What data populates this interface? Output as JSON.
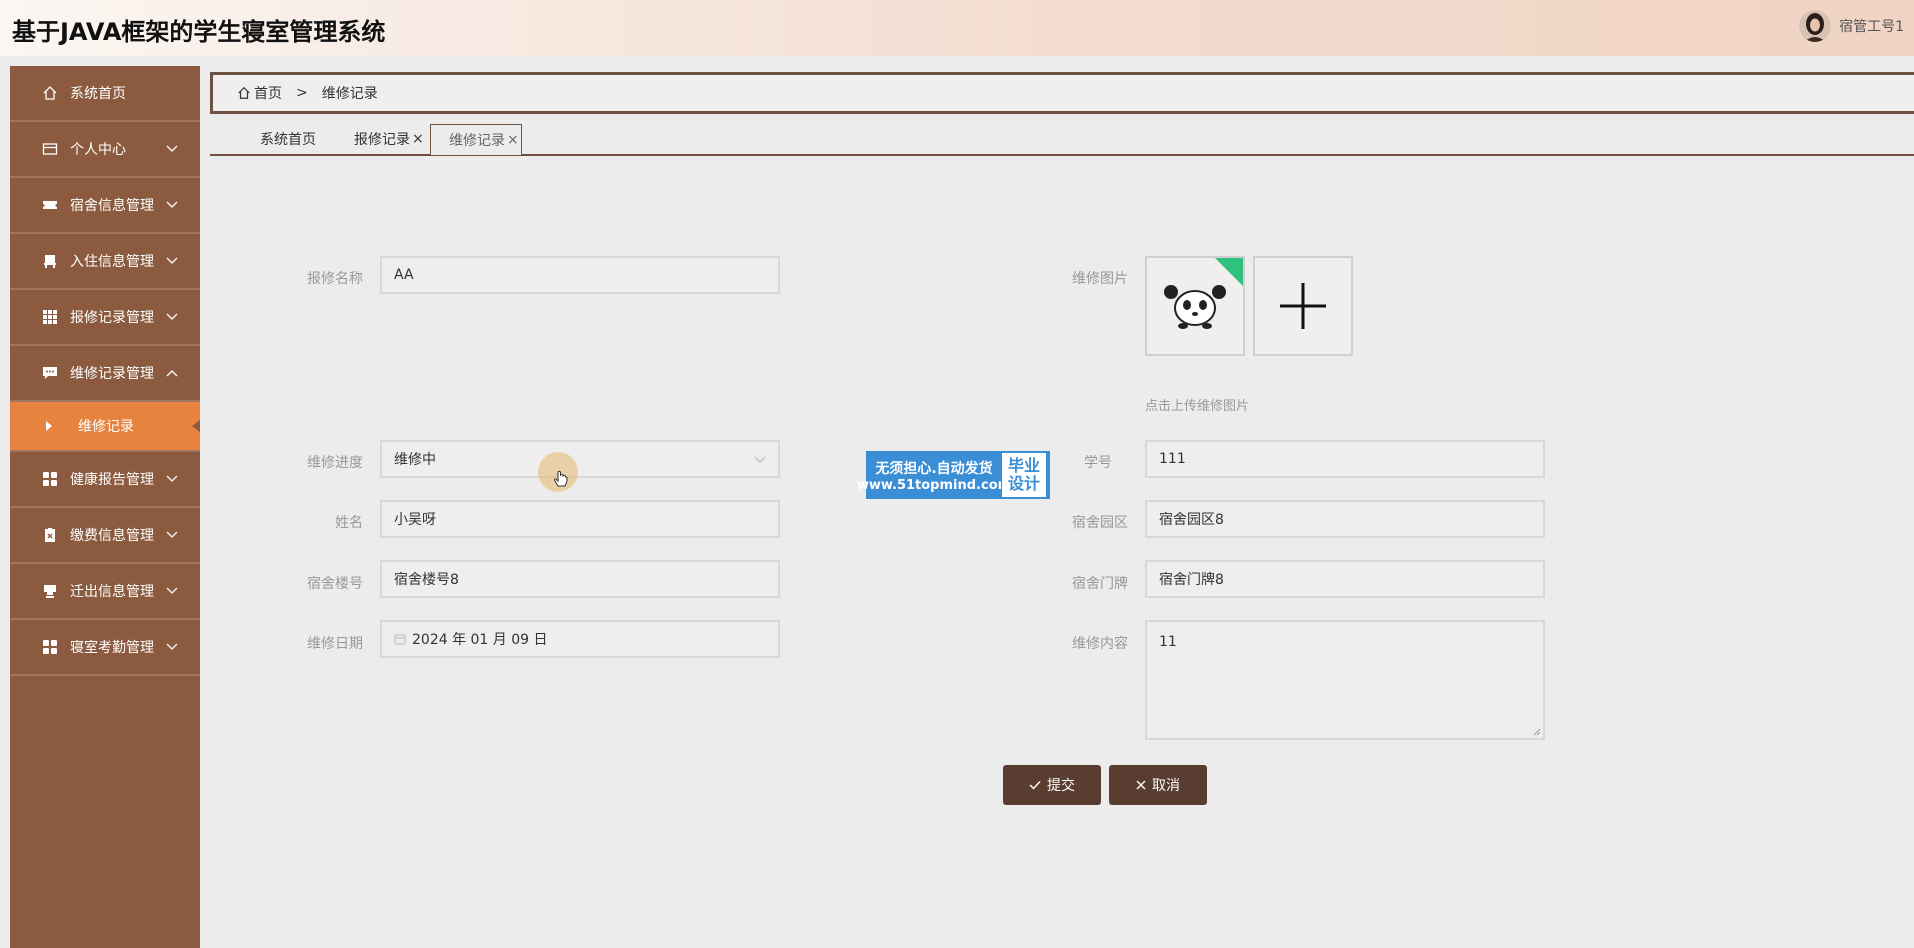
{
  "header": {
    "title": "基于JAVA框架的学生寝室管理系统",
    "user": "宿管工号1"
  },
  "sidebar": {
    "items": [
      {
        "label": "系统首页",
        "icon": "home-icon"
      },
      {
        "label": "个人中心",
        "icon": "card-icon"
      },
      {
        "label": "宿舍信息管理",
        "icon": "ticket-icon"
      },
      {
        "label": "入住信息管理",
        "icon": "chair-icon"
      },
      {
        "label": "报修记录管理",
        "icon": "grid-icon"
      },
      {
        "label": "维修记录管理",
        "icon": "chat-icon"
      },
      {
        "label": "健康报告管理",
        "icon": "apps-icon"
      },
      {
        "label": "缴费信息管理",
        "icon": "clipboard-icon"
      },
      {
        "label": "迁出信息管理",
        "icon": "cup-icon"
      },
      {
        "label": "寝室考勤管理",
        "icon": "apps-icon"
      }
    ],
    "sub_item": "维修记录"
  },
  "breadcrumb": {
    "home": "首页",
    "separator": ">",
    "current": "维修记录"
  },
  "tabs": [
    {
      "label": "系统首页"
    },
    {
      "label": "报修记录",
      "close": "×"
    },
    {
      "label": "维修记录",
      "close": "×"
    }
  ],
  "form": {
    "report_name": {
      "label": "报修名称",
      "value": "AA"
    },
    "repair_image": {
      "label": "维修图片",
      "hint": "点击上传维修图片"
    },
    "progress": {
      "label": "维修进度",
      "value": "维修中"
    },
    "student_no": {
      "label": "学号",
      "value": "111"
    },
    "name": {
      "label": "姓名",
      "value": "小吴呀"
    },
    "dorm_park": {
      "label": "宿舍园区",
      "value": "宿舍园区8"
    },
    "dorm_building": {
      "label": "宿舍楼号",
      "value": "宿舍楼号8"
    },
    "dorm_door": {
      "label": "宿舍门牌",
      "value": "宿舍门牌8"
    },
    "repair_date": {
      "label": "维修日期",
      "value": "2024 年 01 月 09 日"
    },
    "repair_content": {
      "label": "维修内容",
      "value": "11"
    }
  },
  "buttons": {
    "submit": "提交",
    "cancel": "取消"
  },
  "promo": {
    "line1": "无须担心.自动发货",
    "line2": "www.51topmind.com",
    "side1": "毕业",
    "side2": "设计"
  }
}
